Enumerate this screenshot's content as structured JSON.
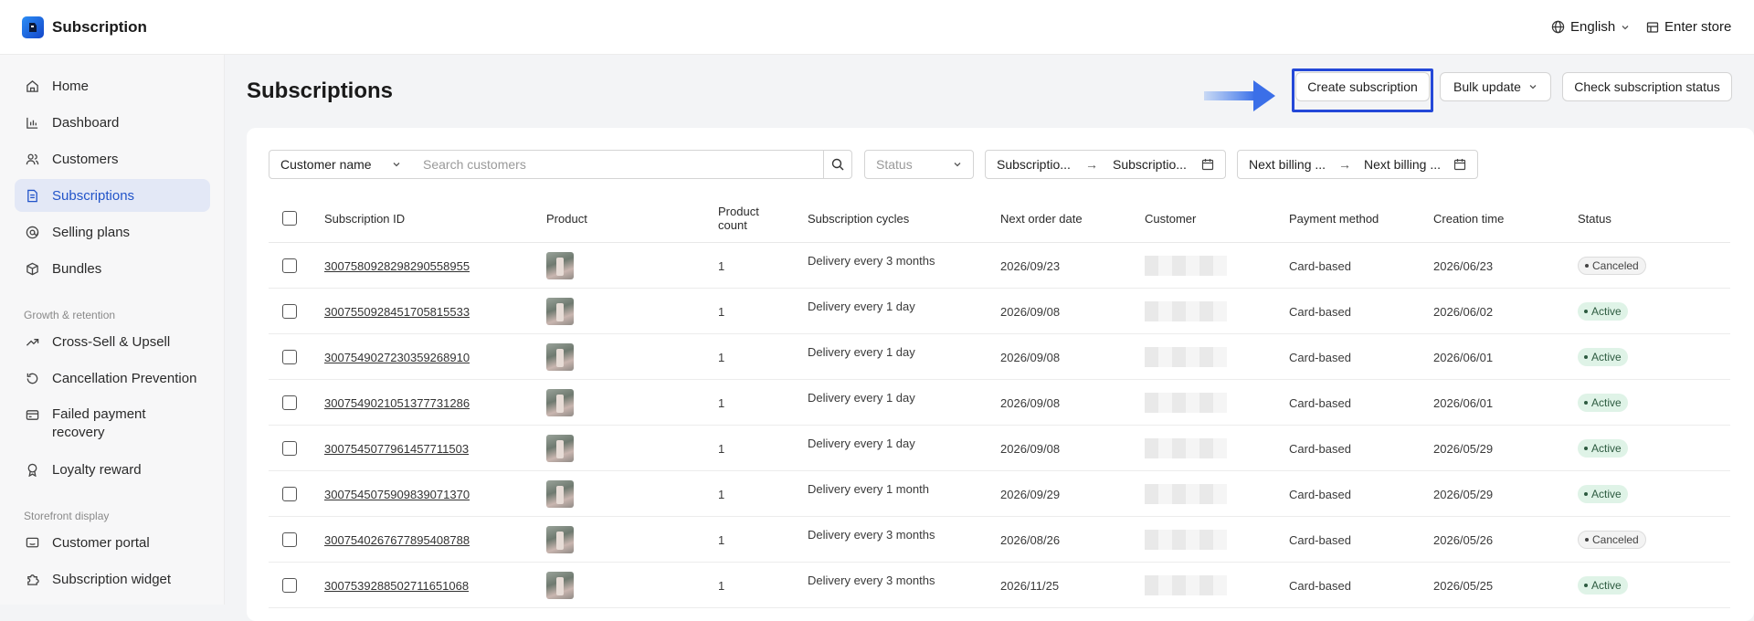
{
  "header": {
    "app_title": "Subscription",
    "language": "English",
    "enter_store": "Enter store"
  },
  "sidebar": {
    "items": [
      {
        "label": "Home",
        "icon": "home-icon"
      },
      {
        "label": "Dashboard",
        "icon": "bar-chart-icon"
      },
      {
        "label": "Customers",
        "icon": "users-icon"
      },
      {
        "label": "Subscriptions",
        "icon": "document-icon",
        "active": true
      },
      {
        "label": "Selling plans",
        "icon": "at-icon"
      },
      {
        "label": "Bundles",
        "icon": "box-icon"
      }
    ],
    "section_growth": "Growth & retention",
    "growth_items": [
      {
        "label": "Cross-Sell & Upsell",
        "icon": "trend-icon"
      },
      {
        "label": "Cancellation Prevention",
        "icon": "refresh-icon"
      },
      {
        "label": "Failed payment recovery",
        "icon": "card-icon"
      },
      {
        "label": "Loyalty reward",
        "icon": "medal-icon"
      }
    ],
    "section_storefront": "Storefront display",
    "storefront_items": [
      {
        "label": "Customer portal",
        "icon": "portal-icon"
      },
      {
        "label": "Subscription widget",
        "icon": "puzzle-icon"
      }
    ]
  },
  "page": {
    "title": "Subscriptions",
    "create_button": "Create subscription",
    "bulk_update": "Bulk update",
    "check_status": "Check subscription status"
  },
  "filters": {
    "field_select": "Customer name",
    "search_placeholder": "Search customers",
    "status_placeholder": "Status",
    "subscription_range_start": "Subscriptio...",
    "subscription_range_end": "Subscriptio...",
    "billing_range_start": "Next billing ...",
    "billing_range_end": "Next billing ..."
  },
  "table": {
    "headers": {
      "subscription_id": "Subscription ID",
      "product": "Product",
      "product_count_1": "Product",
      "product_count_2": "count",
      "cycles": "Subscription cycles",
      "next_order": "Next order date",
      "customer": "Customer",
      "payment": "Payment method",
      "created": "Creation time",
      "status": "Status"
    },
    "rows": [
      {
        "id": "300758092829829055895 5",
        "count": "1",
        "cycle": "Delivery every 3 months",
        "next": "2026/09/23",
        "payment": "Card-based",
        "created": "2026/06/23",
        "status": "Canceled"
      },
      {
        "id": "300755092845170581553 3",
        "count": "1",
        "cycle": "Delivery every 1 day",
        "next": "2026/09/08",
        "payment": "Card-based",
        "created": "2026/06/02",
        "status": "Active"
      },
      {
        "id": "300754902723035926891 0",
        "count": "1",
        "cycle": "Delivery every 1 day",
        "next": "2026/09/08",
        "payment": "Card-based",
        "created": "2026/06/01",
        "status": "Active"
      },
      {
        "id": "300754902105137773128 6",
        "count": "1",
        "cycle": "Delivery every 1 day",
        "next": "2026/09/08",
        "payment": "Card-based",
        "created": "2026/06/01",
        "status": "Active"
      },
      {
        "id": "300754507796145771150 3",
        "count": "1",
        "cycle": "Delivery every 1 day",
        "next": "2026/09/08",
        "payment": "Card-based",
        "created": "2026/05/29",
        "status": "Active"
      },
      {
        "id": "300754507590983907137 0",
        "count": "1",
        "cycle": "Delivery every 1 month",
        "next": "2026/09/29",
        "payment": "Card-based",
        "created": "2026/05/29",
        "status": "Active"
      },
      {
        "id": "300754026767789540878 8",
        "count": "1",
        "cycle": "Delivery every 3 months",
        "next": "2026/08/26",
        "payment": "Card-based",
        "created": "2026/05/26",
        "status": "Canceled"
      },
      {
        "id": "300753928850271165106 8",
        "count": "1",
        "cycle": "Delivery every 3 months",
        "next": "2026/11/25",
        "payment": "Card-based",
        "created": "2026/05/25",
        "status": "Active"
      }
    ]
  },
  "colors": {
    "accent": "#2254c9",
    "highlight": "#2448d8",
    "arrow": "#4a86f0",
    "active_badge": "#dff3e7"
  }
}
